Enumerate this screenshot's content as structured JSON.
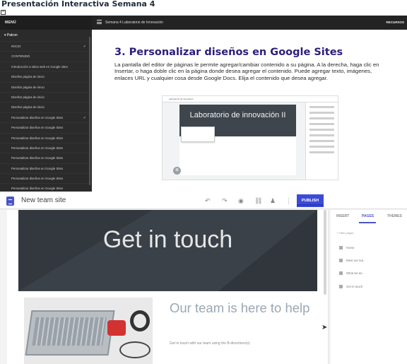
{
  "page": {
    "title": "Presentación Interactiva Semana 4",
    "close_glyph": "×"
  },
  "sidebar": {
    "menu_label": "MENÚ",
    "section": "Patron",
    "items": [
      {
        "label": "INICIO",
        "checked": true
      },
      {
        "label": "CONTENIDO",
        "checked": false
      },
      {
        "label": "Introducción a sitios web en Google sites",
        "checked": false
      },
      {
        "label": "Diseñar página de inicio",
        "checked": false
      },
      {
        "label": "Diseñar página de inicio",
        "checked": false
      },
      {
        "label": "Diseñar página de inicio",
        "checked": false
      },
      {
        "label": "Diseñar página de inicio",
        "checked": false
      },
      {
        "label": "Personalizar diseños en Google Sites",
        "checked": true
      },
      {
        "label": "Personalizar diseños en Google Sites",
        "checked": false
      },
      {
        "label": "Personalizar diseños en Google Sites",
        "checked": false
      },
      {
        "label": "Personalizar diseños en Google Sites",
        "checked": false
      },
      {
        "label": "Personalizar diseños en Google Sites",
        "checked": false
      },
      {
        "label": "Personalizar diseños en Google Sites",
        "checked": false
      },
      {
        "label": "Personalizar diseños en Google Sites",
        "checked": false
      },
      {
        "label": "Personalizar diseños en Google Sites",
        "checked": false
      }
    ],
    "check_glyph": "✓"
  },
  "topbar": {
    "breadcrumb": "Semana 4 Laboratorio de Innovación",
    "resources": "RECURSOS"
  },
  "content": {
    "heading": "3. Personalizar diseños en Google Sites",
    "body": "La pantalla del editor de páginas le permite agregar/cambiar contenido a su página. A la derecha, haga clic en Insertar, o haga doble clic en la página donde desea agregar el contenido. Puede agregar texto, imágenes, enlaces URL y cualquier cosa desde Google Docs. Elija el contenido que desea agregar.",
    "mini": {
      "tab": "Laboratorio de innovación",
      "banner_title": "Laboratorio de innovación II"
    }
  },
  "editor": {
    "site_name": "New team site",
    "publish": "PUBLISH",
    "banner_title": "Get in touch",
    "heading": "Our team is here to help",
    "subtext": "Get in touch with our team using the B-directions(s)",
    "tabs": [
      "INSERT",
      "PAGES",
      "THEMES"
    ],
    "active_tab": "PAGES",
    "hint": "+ Filter pages",
    "pages": [
      "Home",
      "Meet our tea",
      "What we do",
      "Get in touch"
    ],
    "toolbar_icons": [
      "undo-icon",
      "redo-icon",
      "preview-icon",
      "link-icon",
      "add-person-icon",
      "more-icon"
    ]
  }
}
